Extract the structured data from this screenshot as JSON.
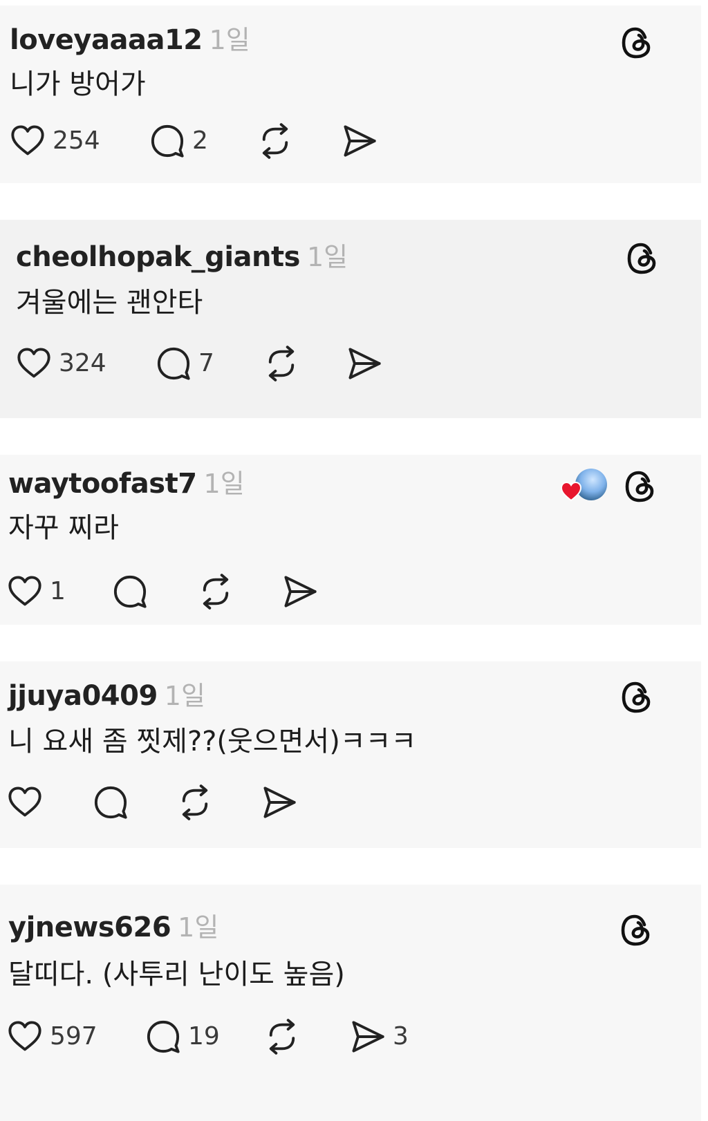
{
  "posts": [
    {
      "username": "loveyaaaa12",
      "time": "1일",
      "text": "니가 방어가",
      "likes": "254",
      "replies": "2",
      "reposts": "",
      "shares": ""
    },
    {
      "username": "cheolhopak_giants",
      "time": "1일",
      "text": "겨울에는 괜안타",
      "likes": "324",
      "replies": "7",
      "reposts": "",
      "shares": ""
    },
    {
      "username": "waytoofast7",
      "time": "1일",
      "text": "자꾸 찌라",
      "likes": "1",
      "replies": "",
      "reposts": "",
      "shares": ""
    },
    {
      "username": "jjuya0409",
      "time": "1일",
      "text": "니 요새 좀 찟제??(웃으면서)ㅋㅋㅋ",
      "likes": "",
      "replies": "",
      "reposts": "",
      "shares": ""
    },
    {
      "username": "yjnews626",
      "time": "1일",
      "text": "달띠다. (사투리 난이도 높음)",
      "likes": "597",
      "replies": "19",
      "reposts": "",
      "shares": "3"
    }
  ],
  "icons": {
    "like": "heart-outline-icon",
    "reply": "speech-bubble-icon",
    "repost": "repost-arrows-icon",
    "share": "paper-plane-icon",
    "app": "threads-logo-icon",
    "liked_by_author": "red-heart-icon"
  },
  "colors": {
    "card_background": "#f7f7f7",
    "card_background_alt": "#f2f2f2",
    "username": "#222222",
    "timestamp": "#b3b3b3",
    "icon": "#222222",
    "heart_badge": "#e8162e"
  }
}
